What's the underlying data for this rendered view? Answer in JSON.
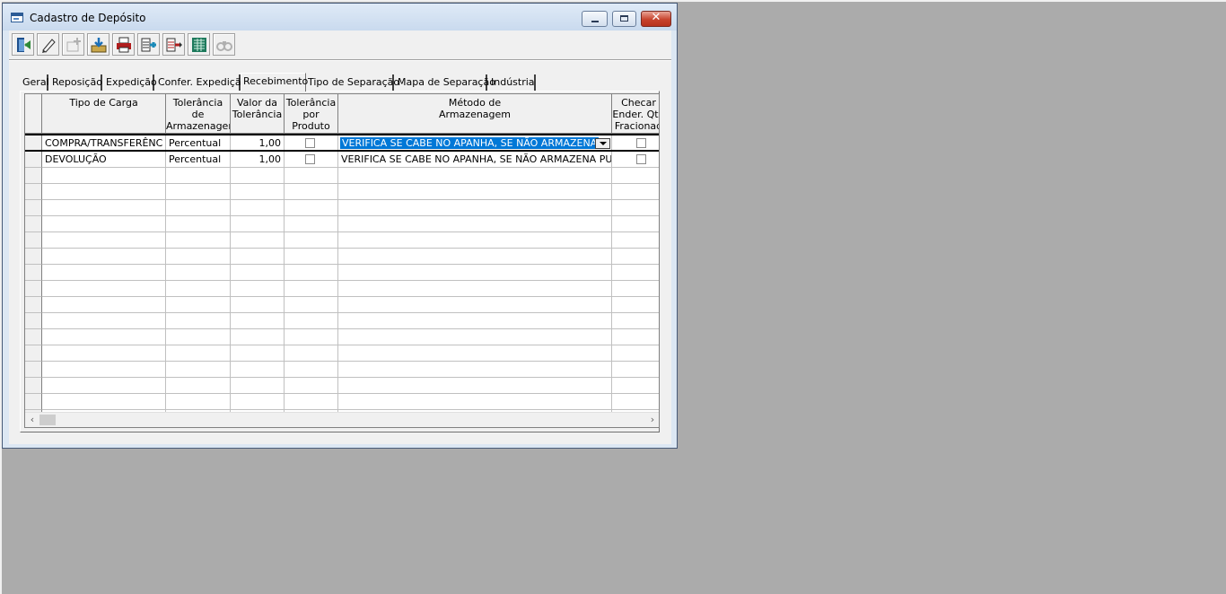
{
  "window": {
    "title": "Cadastro de Depósito",
    "close_glyph": "✕"
  },
  "toolbar": {
    "buttons": [
      {
        "name": "exit-icon",
        "enabled": true
      },
      {
        "name": "edit-pencil-icon",
        "enabled": true
      },
      {
        "name": "add-disabled-icon",
        "enabled": false
      },
      {
        "name": "save-download-icon",
        "enabled": true
      },
      {
        "name": "print-icon",
        "enabled": true
      },
      {
        "name": "insert-row-icon",
        "enabled": true
      },
      {
        "name": "delete-row-icon",
        "enabled": true
      },
      {
        "name": "spreadsheet-icon",
        "enabled": true
      },
      {
        "name": "binoculars-icon",
        "enabled": false
      }
    ]
  },
  "tabs": [
    "Geral",
    "Reposição",
    "Expedição",
    "Confer. Expedição",
    "Recebimento",
    "Tipo de Separação",
    "Mapa de Separação",
    "Indústria"
  ],
  "active_tab": "Recebimento",
  "grid": {
    "columns": [
      "Tipo de Carga",
      "Tolerância de\nArmazenagem",
      "Valor da\nTolerância",
      "Tolerância\npor Produto",
      "Método de\nArmazenagem",
      "Checar\nEnder. Qtd\nFracionad"
    ],
    "rows": [
      {
        "tipo": "COMPRA/TRANSFERÊNC",
        "tolerancia": "Percentual",
        "valor": "1,00",
        "por_produto": false,
        "metodo": "VERIFICA SE CABE NO APANHA, SE NÃO ARMAZENA",
        "checar": false
      },
      {
        "tipo": "DEVOLUÇÃO",
        "tolerancia": "Percentual",
        "valor": "1,00",
        "por_produto": false,
        "metodo": "VERIFICA SE CABE NO APANHA, SE NÃO ARMAZENA PULM",
        "checar": false
      }
    ],
    "scroll_left": "‹",
    "scroll_right": "›"
  },
  "colors": {
    "selection": "#0078d7",
    "workspace": "#ababab",
    "frame": "#dce7f3"
  }
}
